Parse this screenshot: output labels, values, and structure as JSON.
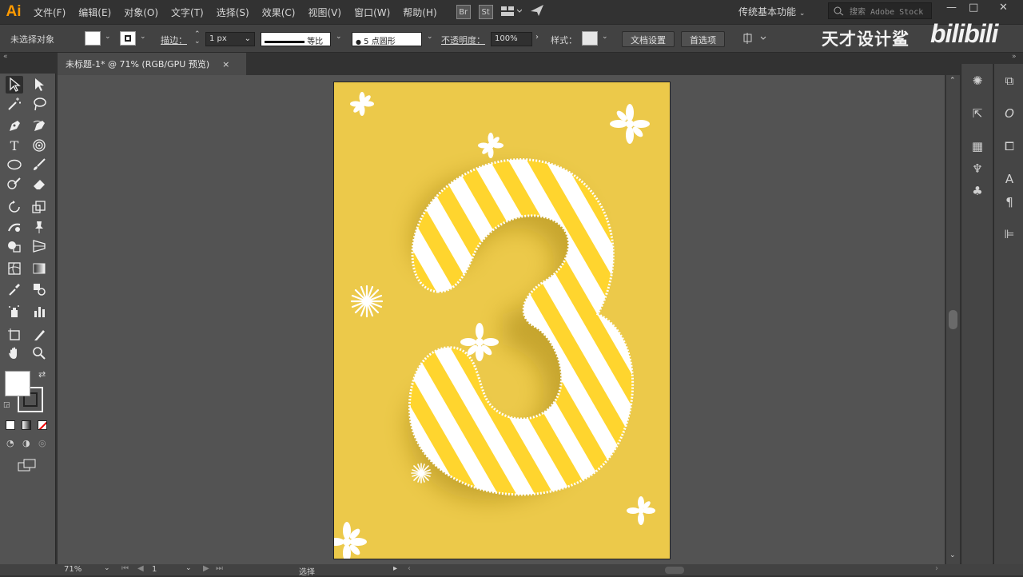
{
  "app": {
    "logo": "Ai"
  },
  "menu": [
    "文件(F)",
    "编辑(E)",
    "对象(O)",
    "文字(T)",
    "选择(S)",
    "效果(C)",
    "视图(V)",
    "窗口(W)",
    "帮助(H)"
  ],
  "menu_badges": [
    "Br",
    "St"
  ],
  "workspace": {
    "label": "传统基本功能"
  },
  "search": {
    "placeholder": "搜索 Adobe Stock"
  },
  "window_controls": [
    "—",
    "□",
    "✕"
  ],
  "control_bar": {
    "selection_status": "未选择对象",
    "stroke_label": "描边：",
    "stroke_weight": "1 px",
    "stroke_profile": "等比",
    "brush": "5 点圆形",
    "opacity_label": "不透明度：",
    "opacity_value": "100%",
    "style_label": "样式：",
    "doc_setup_button": "文档设置",
    "preferences_button": "首选项"
  },
  "watermark": {
    "text": "天才设计鲨",
    "logo": "bilibili"
  },
  "document_tab": {
    "title": "未标题-1* @ 71% (RGB/GPU 预览)",
    "close": "×"
  },
  "artboard": {
    "background": "#ecc94a",
    "stripe_color": "#ffd52e",
    "figure": "3"
  },
  "status": {
    "zoom": "71%",
    "page": "1",
    "tool": "选择"
  },
  "colors": {
    "fill": "#ffffff",
    "stroke": "#000000"
  },
  "icons": [
    "selection-icon",
    "direct-selection-icon",
    "magic-wand-icon",
    "lasso-icon",
    "pen-icon",
    "curvature-icon",
    "type-icon",
    "spiral-icon",
    "ellipse-icon",
    "paintbrush-icon",
    "shaper-icon",
    "eraser-icon",
    "rotate-icon",
    "scale-icon",
    "warp-icon",
    "pin-icon",
    "shape-builder-icon",
    "perspective-icon",
    "mesh-icon",
    "gradient-icon",
    "eyedropper-icon",
    "blend-icon",
    "symbol-sprayer-icon",
    "column-graph-icon",
    "artboard-icon",
    "slice-icon",
    "hand-icon",
    "zoom-icon"
  ]
}
